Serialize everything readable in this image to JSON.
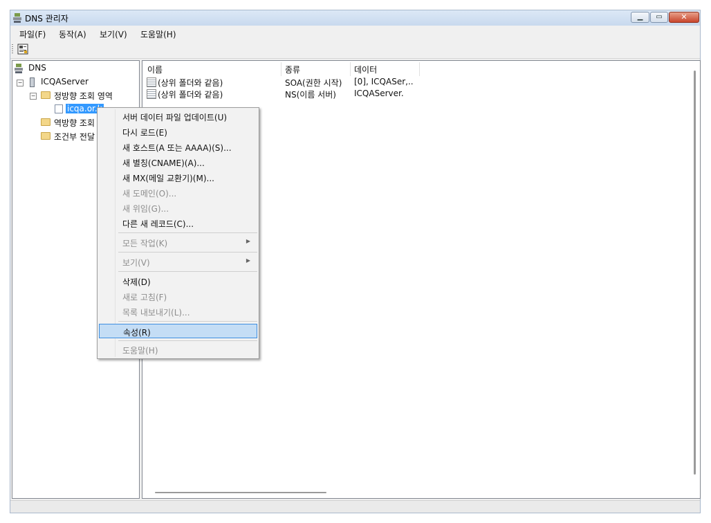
{
  "window": {
    "title": "DNS 관리자"
  },
  "menubar": [
    "파일(F)",
    "동작(A)",
    "보기(V)",
    "도움말(H)"
  ],
  "tree": {
    "root": "DNS",
    "server": "ICQAServer",
    "forward_zone": "정방향 조회 영역",
    "zone": "icqa.or.k",
    "reverse_zone": "역방향 조회",
    "conditional": "조건부 전달"
  },
  "list": {
    "columns": [
      "이름",
      "종류",
      "데이터"
    ],
    "rows": [
      {
        "name": "(상위 폴더와 같음)",
        "type": "SOA(권한 시작)",
        "data": "[0], ICQASer,.."
      },
      {
        "name": "(상위 폴더와 같음)",
        "type": "NS(이름 서버)",
        "data": "ICQAServer."
      }
    ]
  },
  "context_menu": {
    "items": [
      {
        "label": "서버 데이터 파일 업데이트(U)",
        "disabled": false
      },
      {
        "label": "다시 로드(E)",
        "disabled": false
      },
      {
        "label": "새 호스트(A 또는 AAAA)(S)...",
        "disabled": false
      },
      {
        "label": "새 별칭(CNAME)(A)...",
        "disabled": false
      },
      {
        "label": "새 MX(메일 교환기)(M)...",
        "disabled": false
      },
      {
        "label": "새 도메인(O)...",
        "disabled": true
      },
      {
        "label": "새 위임(G)...",
        "disabled": true
      },
      {
        "label": "다른 새 레코드(C)...",
        "disabled": false
      },
      {
        "label": "모든 작업(K)",
        "disabled": true,
        "submenu": true
      },
      {
        "label": "보기(V)",
        "disabled": true,
        "submenu": true
      },
      {
        "label": "삭제(D)",
        "disabled": false
      },
      {
        "label": "새로 고침(F)",
        "disabled": true
      },
      {
        "label": "목록 내보내기(L)...",
        "disabled": true
      },
      {
        "label": "속성(R)",
        "disabled": false,
        "highlighted": true
      },
      {
        "label": "도움말(H)",
        "disabled": true
      }
    ]
  },
  "colors": {
    "selection": "#3399ff",
    "menu_highlight": "#c4ddf5",
    "close_button": "#c8452c"
  }
}
